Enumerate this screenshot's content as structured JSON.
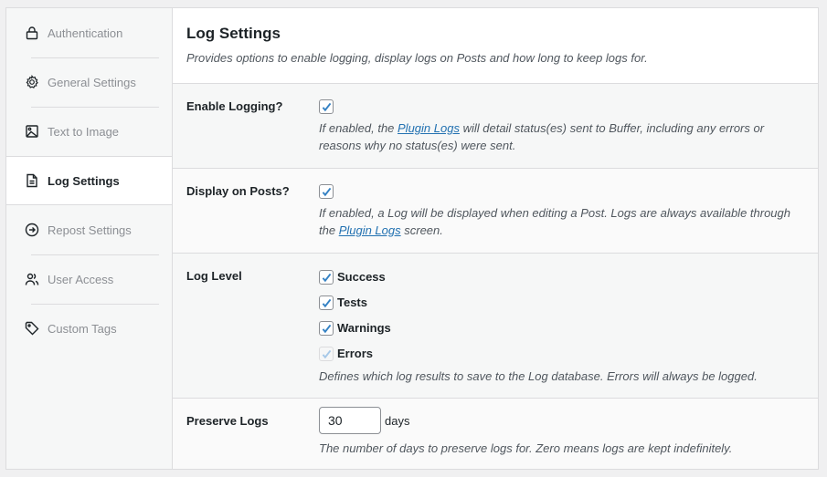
{
  "sidebar": {
    "items": [
      {
        "label": "Authentication",
        "icon": "lock-icon",
        "active": false
      },
      {
        "label": "General Settings",
        "icon": "gear-icon",
        "active": false
      },
      {
        "label": "Text to Image",
        "icon": "image-icon",
        "active": false
      },
      {
        "label": "Log Settings",
        "icon": "document-icon",
        "active": true
      },
      {
        "label": "Repost Settings",
        "icon": "arrow-circle-right-icon",
        "active": false
      },
      {
        "label": "User Access",
        "icon": "users-icon",
        "active": false
      },
      {
        "label": "Custom Tags",
        "icon": "tag-icon",
        "active": false
      }
    ]
  },
  "main": {
    "title": "Log Settings",
    "subtitle": "Provides options to enable logging, display logs on Posts and how long to keep logs for.",
    "enable_logging": {
      "label": "Enable Logging?",
      "checked": true,
      "desc_before": "If enabled, the ",
      "link": "Plugin Logs",
      "desc_after": " will detail status(es) sent to Buffer, including any errors or reasons why no status(es) were sent."
    },
    "display_on_posts": {
      "label": "Display on Posts?",
      "checked": true,
      "desc_before": "If enabled, a Log will be displayed when editing a Post. Logs are always available through the ",
      "link": "Plugin Logs",
      "desc_after": " screen."
    },
    "log_level": {
      "label": "Log Level",
      "options": [
        {
          "label": "Success",
          "checked": true,
          "disabled": false
        },
        {
          "label": "Tests",
          "checked": true,
          "disabled": false
        },
        {
          "label": "Warnings",
          "checked": true,
          "disabled": false
        },
        {
          "label": "Errors",
          "checked": true,
          "disabled": true
        }
      ],
      "description": "Defines which log results to save to the Log database. Errors will always be logged."
    },
    "preserve_logs": {
      "label": "Preserve Logs",
      "value": "30",
      "suffix": "days",
      "description": "The number of days to preserve logs for. Zero means logs are kept indefinitely."
    }
  },
  "colors": {
    "accent": "#2271b1",
    "checkmark": "#3582c4"
  }
}
